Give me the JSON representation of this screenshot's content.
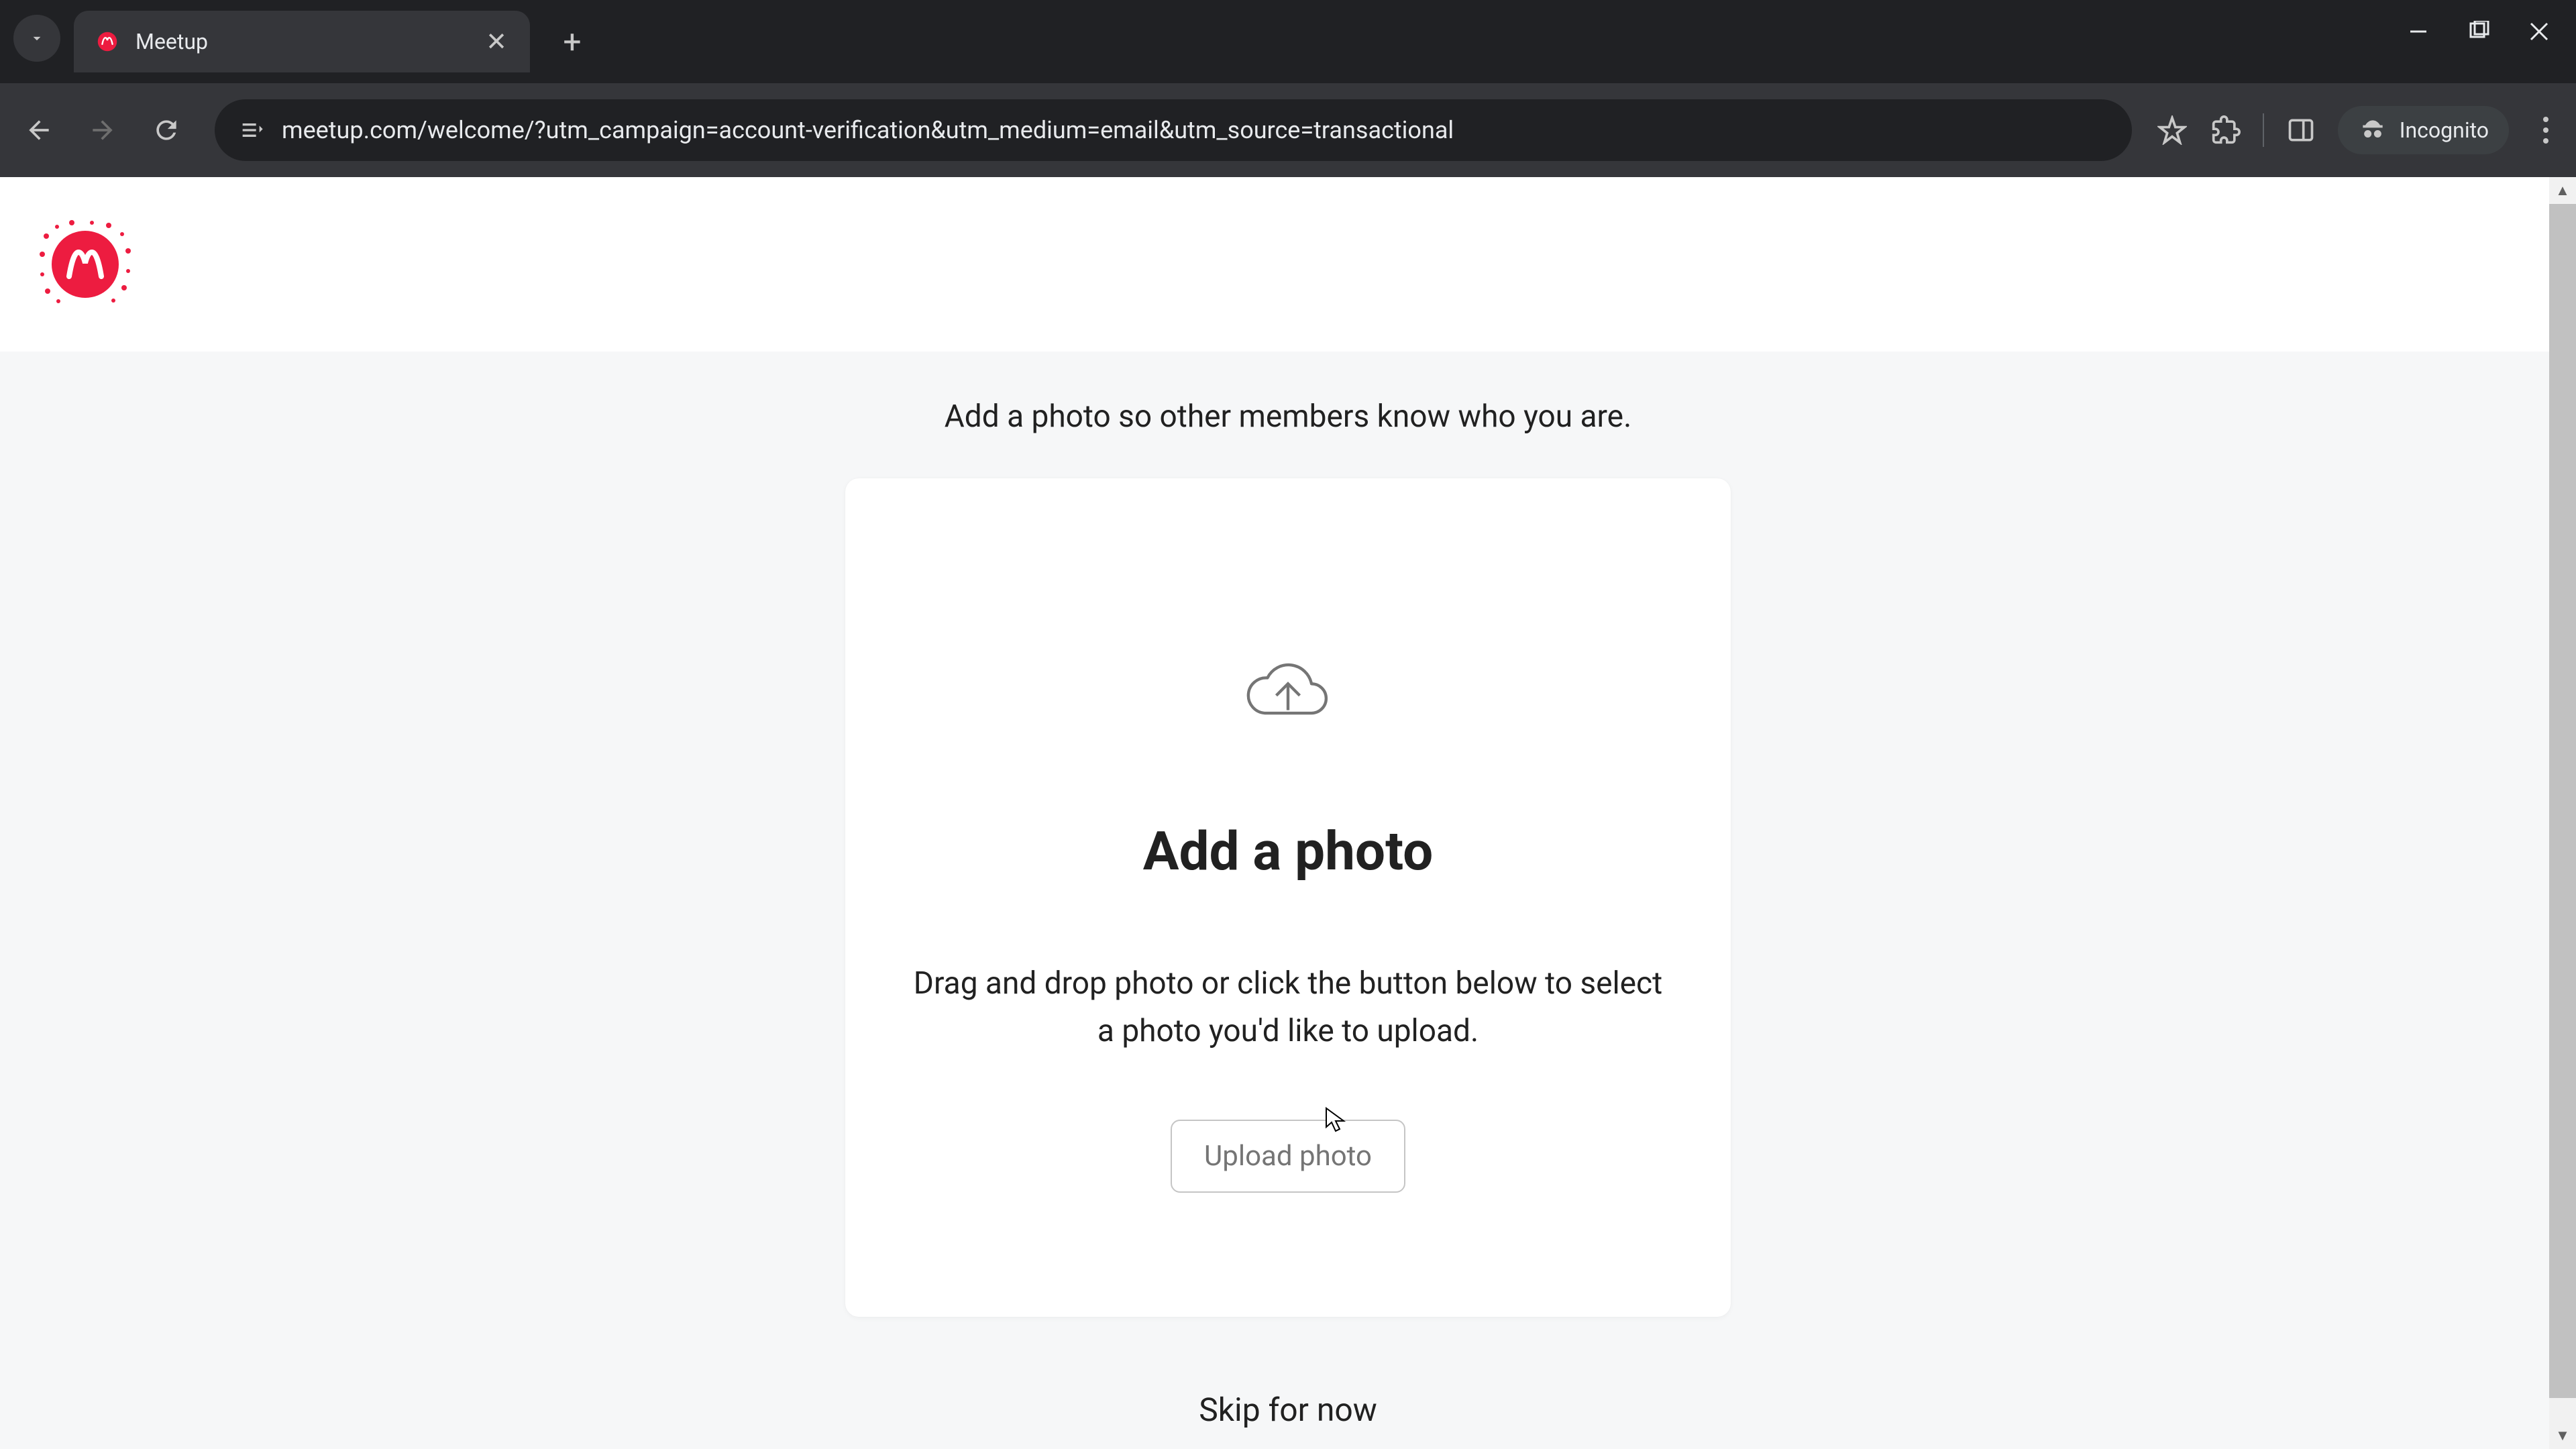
{
  "browser": {
    "tab": {
      "title": "Meetup"
    },
    "url": "meetup.com/welcome/?utm_campaign=account-verification&utm_medium=email&utm_source=transactional",
    "incognito_label": "Incognito"
  },
  "page": {
    "subtitle": "Add a photo so other members know who you are.",
    "card": {
      "title": "Add a photo",
      "description": "Drag and drop photo or click the button below to select a photo you'd like to upload.",
      "upload_button_label": "Upload photo"
    },
    "skip_link_label": "Skip for now"
  }
}
